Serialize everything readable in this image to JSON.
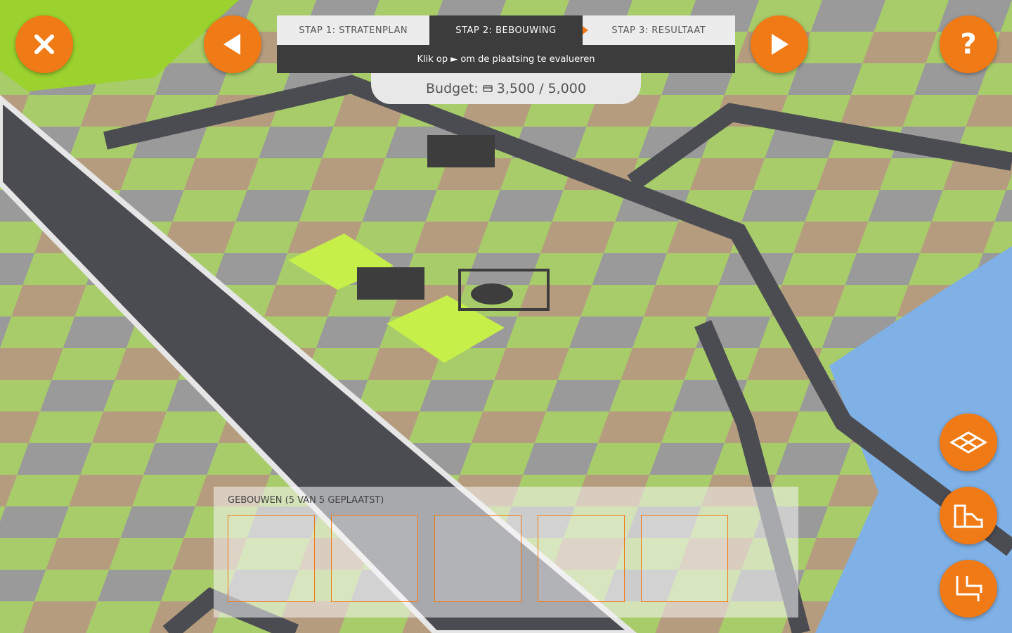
{
  "steps": [
    {
      "label": "STAP 1: STRATENPLAN",
      "state": "done"
    },
    {
      "label": "STAP 2: BEBOUWING",
      "state": "active"
    },
    {
      "label": "STAP 3: RESULTAAT",
      "state": "todo"
    }
  ],
  "hint": "Klik op ► om de plaatsing te evalueren",
  "budget": {
    "label": "Budget:",
    "used": "3,500",
    "separator": "/",
    "total": "5,000"
  },
  "panel": {
    "title": "GEBOUWEN (5 VAN 5 GEPLAATST)",
    "slot_count": 5
  },
  "buttons": {
    "close_icon": "close-icon",
    "prev_icon": "triangle-left-icon",
    "next_icon": "triangle-right-icon",
    "help_glyph": "?",
    "tool_icons": [
      "grid-tiles-icon",
      "buildings-icon",
      "road-icon"
    ]
  },
  "colors": {
    "accent": "#f07a15",
    "dark": "#3c3c3c",
    "grass": "#a8cc6a",
    "highlight": "#c6ef4a",
    "water": "#7fb0e6",
    "road": "#4a4c52"
  }
}
